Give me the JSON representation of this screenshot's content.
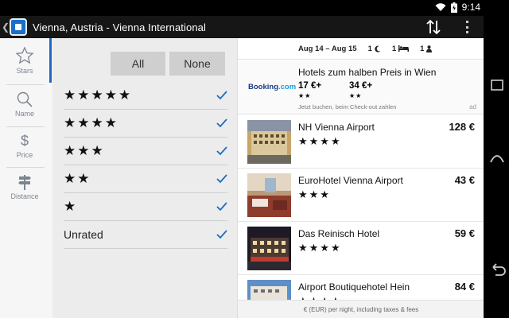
{
  "status": {
    "time": "9:14"
  },
  "header": {
    "title": "Vienna, Austria - Vienna International"
  },
  "rail": [
    {
      "label": "Stars",
      "icon": "star-outline-icon"
    },
    {
      "label": "Name",
      "icon": "magnifier-icon"
    },
    {
      "label": "Price",
      "icon": "dollar-icon"
    },
    {
      "label": "Distance",
      "icon": "signpost-icon"
    }
  ],
  "filter": {
    "all_label": "All",
    "none_label": "None",
    "rows": [
      {
        "stars": "★★★★★",
        "checked": true
      },
      {
        "stars": "★★★★",
        "checked": true
      },
      {
        "stars": "★★★",
        "checked": true
      },
      {
        "stars": "★★",
        "checked": true
      },
      {
        "stars": "★",
        "checked": true
      },
      {
        "text": "Unrated",
        "checked": true
      }
    ],
    "accent": "#1c6bc2"
  },
  "dates": {
    "range": "Aug 14 – Aug 15",
    "nights": "1",
    "rooms": "1",
    "guests": "1"
  },
  "ad": {
    "brand": "Booking",
    "brand_suffix": ".com",
    "headline": "Hotels zum halben Preis in Wien",
    "price1": "17 €+",
    "stars1": "★★",
    "price2": "34 €+",
    "stars2": "★★",
    "subtext": "Jetzt buchen, beim Check-out zahlen",
    "tag": "ad"
  },
  "hotels": [
    {
      "name": "NH Vienna Airport",
      "stars": "★★★★",
      "price": "128 €"
    },
    {
      "name": "EuroHotel Vienna Airport",
      "stars": "★★★",
      "price": "43 €"
    },
    {
      "name": "Das Reinisch Hotel",
      "stars": "★★★★",
      "price": "59 €"
    },
    {
      "name": "Airport Boutiquehotel Hein",
      "stars": "★★★★",
      "price": "84 €"
    }
  ],
  "footer": "€ (EUR) per night, including taxes & fees"
}
